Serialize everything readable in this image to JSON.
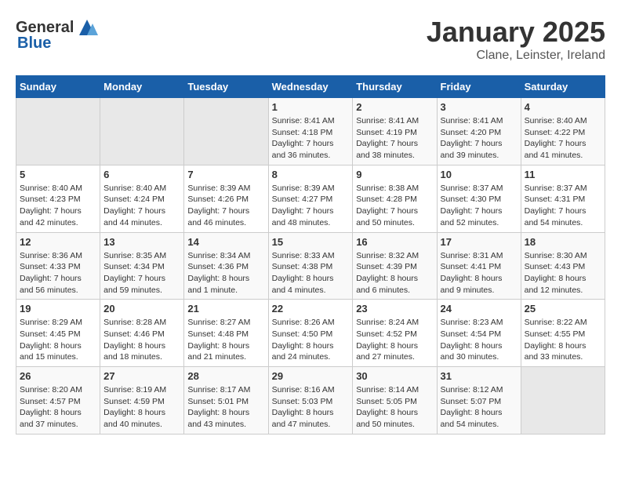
{
  "header": {
    "logo_general": "General",
    "logo_blue": "Blue",
    "month": "January 2025",
    "location": "Clane, Leinster, Ireland"
  },
  "days_of_week": [
    "Sunday",
    "Monday",
    "Tuesday",
    "Wednesday",
    "Thursday",
    "Friday",
    "Saturday"
  ],
  "weeks": [
    [
      {
        "day": "",
        "info": ""
      },
      {
        "day": "",
        "info": ""
      },
      {
        "day": "",
        "info": ""
      },
      {
        "day": "1",
        "info": "Sunrise: 8:41 AM\nSunset: 4:18 PM\nDaylight: 7 hours\nand 36 minutes."
      },
      {
        "day": "2",
        "info": "Sunrise: 8:41 AM\nSunset: 4:19 PM\nDaylight: 7 hours\nand 38 minutes."
      },
      {
        "day": "3",
        "info": "Sunrise: 8:41 AM\nSunset: 4:20 PM\nDaylight: 7 hours\nand 39 minutes."
      },
      {
        "day": "4",
        "info": "Sunrise: 8:40 AM\nSunset: 4:22 PM\nDaylight: 7 hours\nand 41 minutes."
      }
    ],
    [
      {
        "day": "5",
        "info": "Sunrise: 8:40 AM\nSunset: 4:23 PM\nDaylight: 7 hours\nand 42 minutes."
      },
      {
        "day": "6",
        "info": "Sunrise: 8:40 AM\nSunset: 4:24 PM\nDaylight: 7 hours\nand 44 minutes."
      },
      {
        "day": "7",
        "info": "Sunrise: 8:39 AM\nSunset: 4:26 PM\nDaylight: 7 hours\nand 46 minutes."
      },
      {
        "day": "8",
        "info": "Sunrise: 8:39 AM\nSunset: 4:27 PM\nDaylight: 7 hours\nand 48 minutes."
      },
      {
        "day": "9",
        "info": "Sunrise: 8:38 AM\nSunset: 4:28 PM\nDaylight: 7 hours\nand 50 minutes."
      },
      {
        "day": "10",
        "info": "Sunrise: 8:37 AM\nSunset: 4:30 PM\nDaylight: 7 hours\nand 52 minutes."
      },
      {
        "day": "11",
        "info": "Sunrise: 8:37 AM\nSunset: 4:31 PM\nDaylight: 7 hours\nand 54 minutes."
      }
    ],
    [
      {
        "day": "12",
        "info": "Sunrise: 8:36 AM\nSunset: 4:33 PM\nDaylight: 7 hours\nand 56 minutes."
      },
      {
        "day": "13",
        "info": "Sunrise: 8:35 AM\nSunset: 4:34 PM\nDaylight: 7 hours\nand 59 minutes."
      },
      {
        "day": "14",
        "info": "Sunrise: 8:34 AM\nSunset: 4:36 PM\nDaylight: 8 hours\nand 1 minute."
      },
      {
        "day": "15",
        "info": "Sunrise: 8:33 AM\nSunset: 4:38 PM\nDaylight: 8 hours\nand 4 minutes."
      },
      {
        "day": "16",
        "info": "Sunrise: 8:32 AM\nSunset: 4:39 PM\nDaylight: 8 hours\nand 6 minutes."
      },
      {
        "day": "17",
        "info": "Sunrise: 8:31 AM\nSunset: 4:41 PM\nDaylight: 8 hours\nand 9 minutes."
      },
      {
        "day": "18",
        "info": "Sunrise: 8:30 AM\nSunset: 4:43 PM\nDaylight: 8 hours\nand 12 minutes."
      }
    ],
    [
      {
        "day": "19",
        "info": "Sunrise: 8:29 AM\nSunset: 4:45 PM\nDaylight: 8 hours\nand 15 minutes."
      },
      {
        "day": "20",
        "info": "Sunrise: 8:28 AM\nSunset: 4:46 PM\nDaylight: 8 hours\nand 18 minutes."
      },
      {
        "day": "21",
        "info": "Sunrise: 8:27 AM\nSunset: 4:48 PM\nDaylight: 8 hours\nand 21 minutes."
      },
      {
        "day": "22",
        "info": "Sunrise: 8:26 AM\nSunset: 4:50 PM\nDaylight: 8 hours\nand 24 minutes."
      },
      {
        "day": "23",
        "info": "Sunrise: 8:24 AM\nSunset: 4:52 PM\nDaylight: 8 hours\nand 27 minutes."
      },
      {
        "day": "24",
        "info": "Sunrise: 8:23 AM\nSunset: 4:54 PM\nDaylight: 8 hours\nand 30 minutes."
      },
      {
        "day": "25",
        "info": "Sunrise: 8:22 AM\nSunset: 4:55 PM\nDaylight: 8 hours\nand 33 minutes."
      }
    ],
    [
      {
        "day": "26",
        "info": "Sunrise: 8:20 AM\nSunset: 4:57 PM\nDaylight: 8 hours\nand 37 minutes."
      },
      {
        "day": "27",
        "info": "Sunrise: 8:19 AM\nSunset: 4:59 PM\nDaylight: 8 hours\nand 40 minutes."
      },
      {
        "day": "28",
        "info": "Sunrise: 8:17 AM\nSunset: 5:01 PM\nDaylight: 8 hours\nand 43 minutes."
      },
      {
        "day": "29",
        "info": "Sunrise: 8:16 AM\nSunset: 5:03 PM\nDaylight: 8 hours\nand 47 minutes."
      },
      {
        "day": "30",
        "info": "Sunrise: 8:14 AM\nSunset: 5:05 PM\nDaylight: 8 hours\nand 50 minutes."
      },
      {
        "day": "31",
        "info": "Sunrise: 8:12 AM\nSunset: 5:07 PM\nDaylight: 8 hours\nand 54 minutes."
      },
      {
        "day": "",
        "info": ""
      }
    ]
  ]
}
